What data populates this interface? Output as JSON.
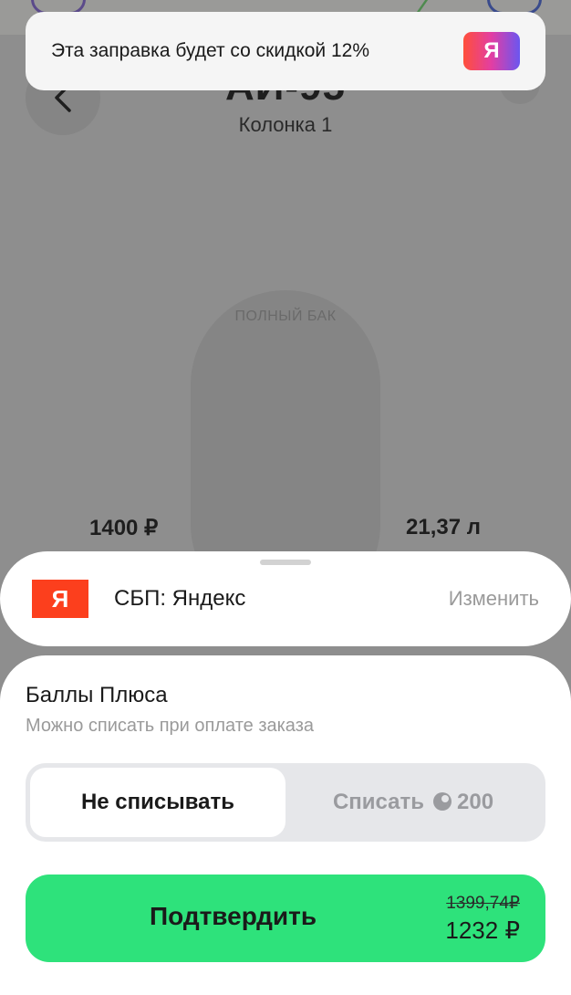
{
  "toast": {
    "text": "Эта заправка будет со скидкой 12%",
    "logo_letter": "Я"
  },
  "header": {
    "fuel": "АИ-95",
    "pump": "Колонка 1",
    "close_glyph": "×"
  },
  "tank": {
    "label": "ПОЛНЫЙ БАК"
  },
  "amounts": {
    "rub": "1400 ₽",
    "liters": "21,37 л"
  },
  "payment": {
    "logo_letter": "Я",
    "method": "СБП: Яндекс",
    "change": "Изменить"
  },
  "plus": {
    "title": "Баллы Плюса",
    "subtitle": "Можно списать при оплате заказа",
    "option_off": "Не списывать",
    "option_on": "Списать",
    "points": "200"
  },
  "confirm": {
    "label": "Подтвердить",
    "old_price": "1399,74₽",
    "new_price": "1232 ₽"
  },
  "colors": {
    "accent_green": "#2ee27b",
    "yandex_red": "#fc3f1d"
  }
}
